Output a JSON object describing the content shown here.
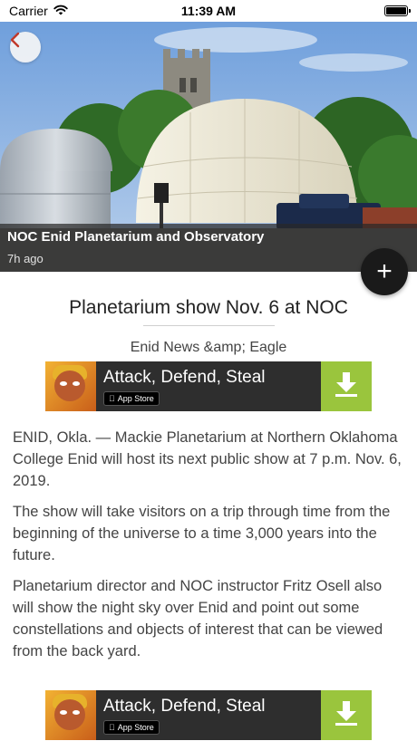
{
  "status_bar": {
    "carrier": "Carrier",
    "time": "11:39 AM",
    "battery_level": 1.0
  },
  "hero": {
    "back_icon": "chevron-left-icon",
    "caption_title": "NOC Enid Planetarium and Observatory",
    "caption_time": "7h ago"
  },
  "fab": {
    "label": "+",
    "icon": "plus-icon"
  },
  "article": {
    "title": "Planetarium show Nov. 6 at NOC",
    "source": "Enid News &amp; Eagle",
    "paragraphs": [
      "ENID, Okla. — Mackie Planetarium at Northern Oklahoma College Enid will host its next public show at 7 p.m. Nov. 6, 2019.",
      "The show will take visitors on a trip through time from the beginning of the universe to a time 3,000 years into the future.",
      "Planetarium director and NOC instructor Fritz Osell also will show the night sky over Enid and point out some constellations and objects of interest that can be viewed from the back yard."
    ]
  },
  "ads": [
    {
      "title": "Attack, Defend, Steal",
      "badge": "App Store"
    },
    {
      "title": "Attack, Defend, Steal",
      "badge": "App Store"
    }
  ],
  "colors": {
    "accent_red": "#c0392b",
    "ad_green": "#9ac53d",
    "ad_bg": "#2e2e2e"
  }
}
